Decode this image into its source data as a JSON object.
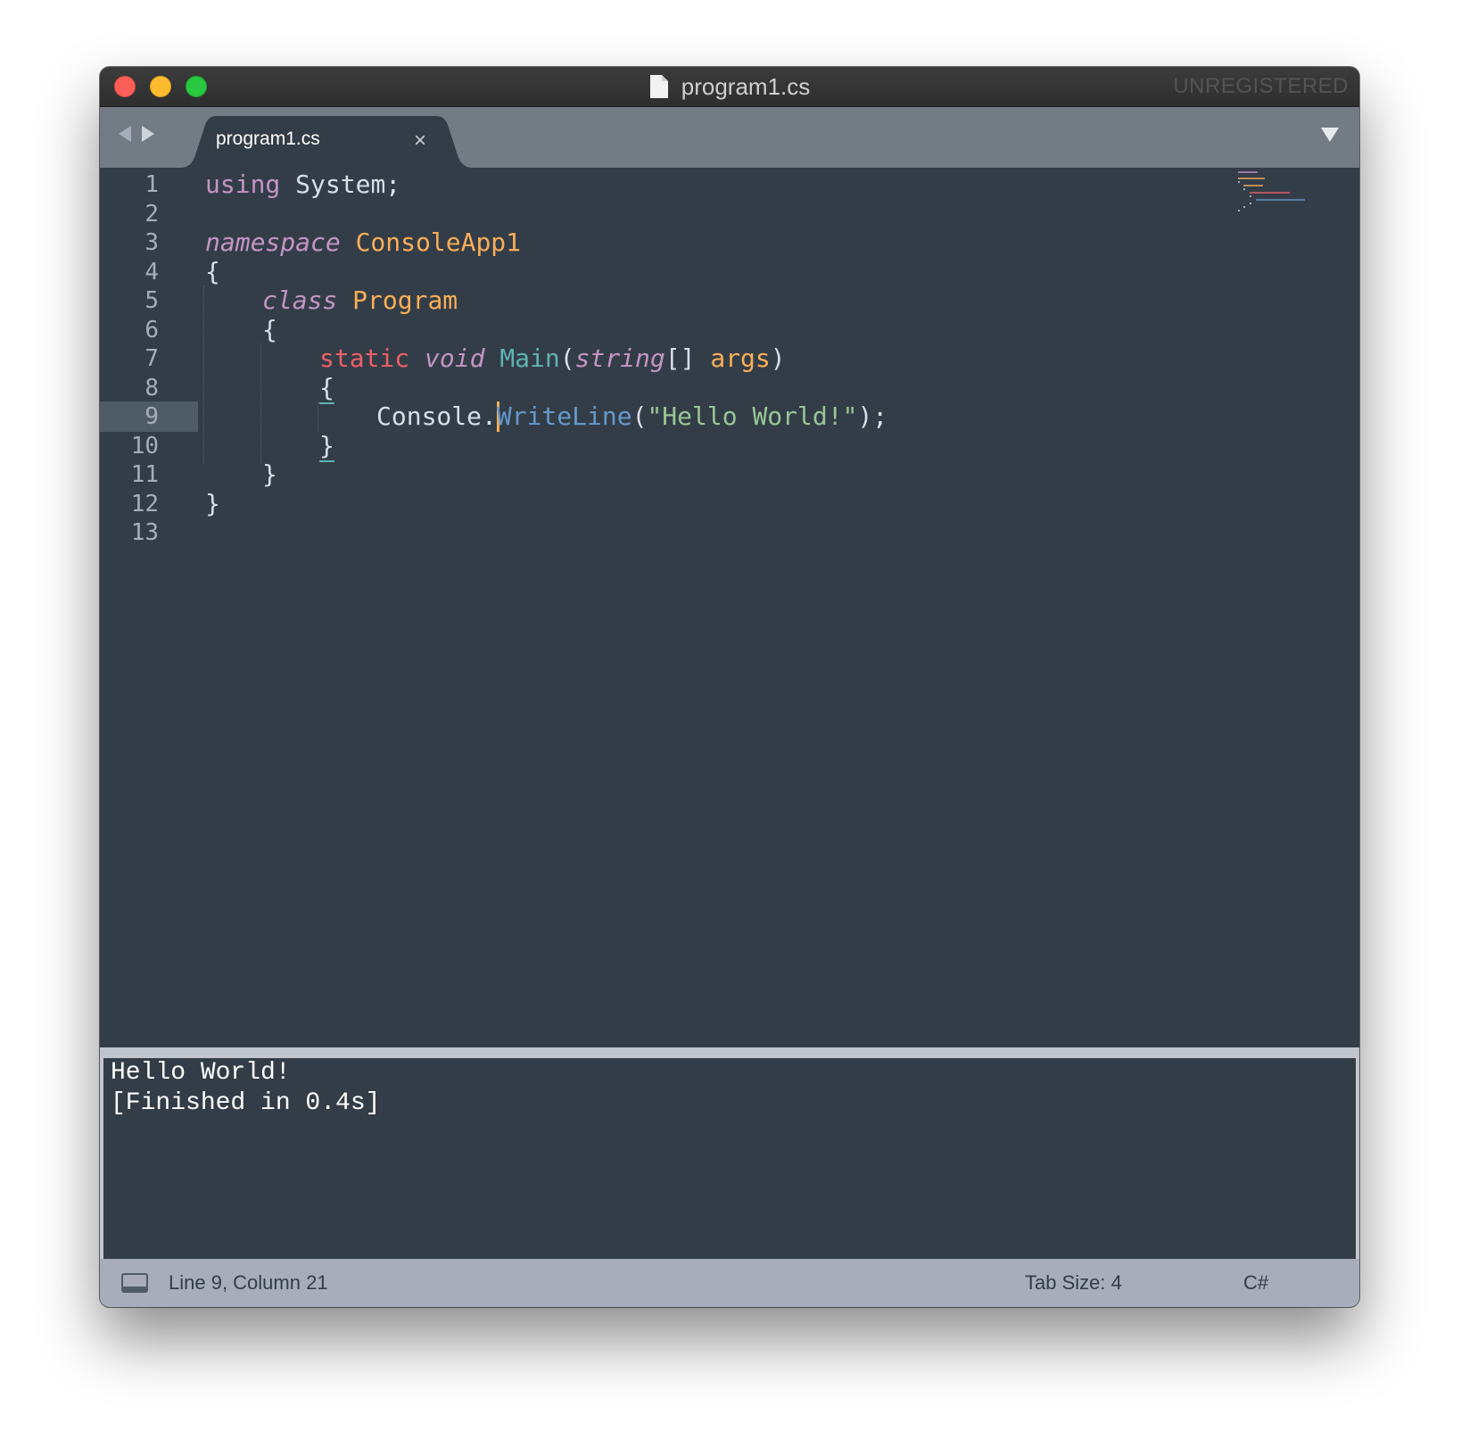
{
  "window": {
    "title": "program1.cs",
    "registration_label": "UNREGISTERED",
    "traffic_lights": [
      "close",
      "minimize",
      "zoom"
    ]
  },
  "tabs": [
    {
      "label": "program1.cs",
      "close_symbol": "×",
      "active": true
    }
  ],
  "editor": {
    "line_numbers": [
      "1",
      "2",
      "3",
      "4",
      "5",
      "6",
      "7",
      "8",
      "9",
      "10",
      "11",
      "12",
      "13"
    ],
    "active_line": "9",
    "code": {
      "l1": {
        "kw": "using",
        "rest": " System;"
      },
      "l3": {
        "kw": "namespace",
        "name": "ConsoleApp1"
      },
      "l4": {
        "brace": "{"
      },
      "l5": {
        "kw": "class",
        "name": "Program"
      },
      "l6": {
        "brace": "{"
      },
      "l7": {
        "static": "static",
        "void": "void",
        "fn": "Main",
        "open": "(",
        "type": "string",
        "arr": "[] ",
        "param": "args",
        "close": ")"
      },
      "l8": {
        "brace": "{"
      },
      "l9": {
        "obj": "Console.",
        "method": "WriteLine",
        "open": "(",
        "str": "\"Hello World!\"",
        "close": ");"
      },
      "l10": {
        "brace": "}"
      },
      "l11": {
        "brace": "}"
      },
      "l12": {
        "brace": "}"
      }
    }
  },
  "output": {
    "lines": [
      "Hello World!",
      "[Finished in 0.4s]"
    ]
  },
  "status": {
    "position": "Line 9, Column 21",
    "tab_size": "Tab Size: 4",
    "syntax": "C#"
  },
  "colors": {
    "editor_bg": "#333d47",
    "keyword": "#c594c5",
    "keyword_red": "#ec5f67",
    "type_name": "#f9ae58",
    "function": "#5fb3b3",
    "method": "#6699cc",
    "string": "#99c794",
    "status_bar": "#a7adba",
    "tab_bar": "#737b84"
  }
}
